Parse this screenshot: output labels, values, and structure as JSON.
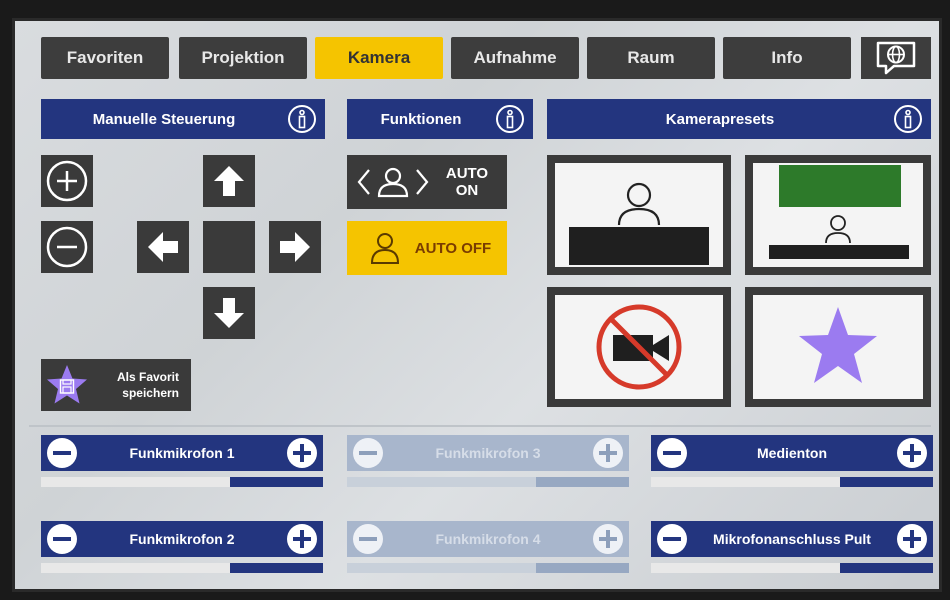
{
  "tabs": [
    {
      "label": "Favoriten",
      "active": false
    },
    {
      "label": "Projektion",
      "active": false
    },
    {
      "label": "Kamera",
      "active": true
    },
    {
      "label": "Aufnahme",
      "active": false
    },
    {
      "label": "Raum",
      "active": false
    },
    {
      "label": "Info",
      "active": false
    }
  ],
  "headers": {
    "manual": "Manuelle Steuerung",
    "functions": "Funktionen",
    "presets": "Kamerapresets"
  },
  "functions": {
    "auto_on": "AUTO ON",
    "auto_off": "AUTO OFF"
  },
  "favorite_button": {
    "line1": "Als Favorit",
    "line2": "speichern"
  },
  "mics": [
    {
      "label": "Funkmikrofon 1",
      "level": 0.33,
      "enabled": true
    },
    {
      "label": "Funkmikrofon 3",
      "level": 0.33,
      "enabled": false
    },
    {
      "label": "Medienton",
      "level": 0.33,
      "enabled": true
    },
    {
      "label": "Funkmikrofon 2",
      "level": 0.33,
      "enabled": true
    },
    {
      "label": "Funkmikrofon 4",
      "level": 0.33,
      "enabled": false
    },
    {
      "label": "Mikrofonanschluss Pult",
      "level": 0.33,
      "enabled": true
    }
  ],
  "colors": {
    "header_blue": "#23357f",
    "active_tab": "#f5c400",
    "button_dark": "#3a3a3a",
    "preset_green": "#2d7a2a",
    "favorite_star": "#9b7bf0",
    "no_camera_red": "#d63a2a"
  }
}
